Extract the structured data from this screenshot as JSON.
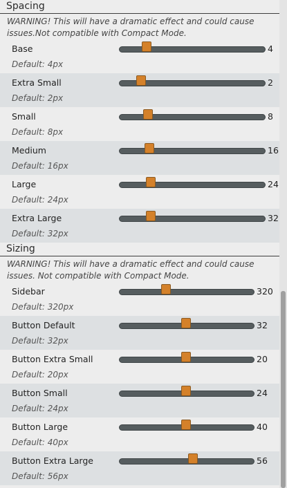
{
  "spacing": {
    "title": "Spacing",
    "warning": "WARNING! This will have a dramatic effect and could cause issues.Not compatible with Compact Mode.",
    "rows": [
      {
        "label": "Base",
        "default": "Default: 4px",
        "value": "4",
        "fraction": 0.19
      },
      {
        "label": "Extra Small",
        "default": "Default: 2px",
        "value": "2",
        "fraction": 0.15
      },
      {
        "label": "Small",
        "default": "Default: 8px",
        "value": "8",
        "fraction": 0.2
      },
      {
        "label": "Medium",
        "default": "Default: 16px",
        "value": "16",
        "fraction": 0.21
      },
      {
        "label": "Large",
        "default": "Default: 24px",
        "value": "24",
        "fraction": 0.22
      },
      {
        "label": "Extra Large",
        "default": "Default: 32px",
        "value": "32",
        "fraction": 0.22
      }
    ]
  },
  "sizing": {
    "title": "Sizing",
    "warning": "WARNING! This will have a dramatic effect and could cause issues. Not compatible with Compact Mode.",
    "rows": [
      {
        "label": "Sidebar",
        "default": "Default: 320px",
        "value": "320",
        "fraction": 0.35
      },
      {
        "label": "Button Default",
        "default": "Default: 32px",
        "value": "32",
        "fraction": 0.5
      },
      {
        "label": "Button Extra Small",
        "default": "Default: 20px",
        "value": "20",
        "fraction": 0.5
      },
      {
        "label": "Button Small",
        "default": "Default: 24px",
        "value": "24",
        "fraction": 0.5
      },
      {
        "label": "Button Large",
        "default": "Default: 40px",
        "value": "40",
        "fraction": 0.5
      },
      {
        "label": "Button Extra Large",
        "default": "Default: 56px",
        "value": "56",
        "fraction": 0.55
      }
    ]
  }
}
